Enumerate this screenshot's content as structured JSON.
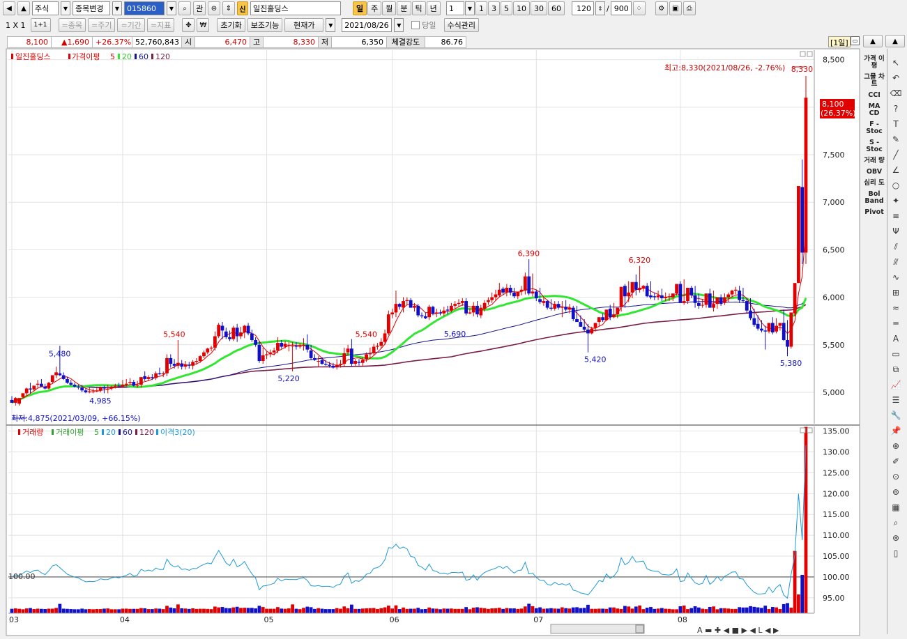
{
  "toolbar": {
    "market": "주식",
    "change_button": "종목변경",
    "code": "015860",
    "gwan": "관",
    "new_badge": "신",
    "stock_name": "일진홀딩스",
    "periods": [
      "일",
      "주",
      "월",
      "분",
      "틱",
      "년"
    ],
    "active_period": "일",
    "interval_value": "1",
    "interval_presets": [
      "1",
      "3",
      "5",
      "10",
      "30",
      "60"
    ],
    "count_value": "120",
    "count_sep": "/",
    "count_total": "900"
  },
  "toolbar2": {
    "layout": "1 X 1",
    "layout_small": "1+1",
    "disabled_buttons": [
      "=종목",
      "=주기",
      "=기간",
      "=지표"
    ],
    "pan_icon": "move-icon",
    "init_button": "초기화",
    "aux_button": "보조기능",
    "price_type": "현재가",
    "date": "2021/08/26",
    "same_day_label": "당일",
    "formula_button": "수식관리"
  },
  "quote": {
    "price": "8,100",
    "change": "▲1,690",
    "rate": "+26.37%",
    "volume": "52,760,843",
    "open_label": "시",
    "open": "6,470",
    "high_label": "고",
    "high": "8,330",
    "low_label": "저",
    "low": "6,350",
    "strength_label": "체결강도",
    "strength": "86.76",
    "period_badge": "[1일]"
  },
  "price_panel": {
    "legend": [
      "일진홀딩스",
      "가격이평",
      "5",
      "20",
      "60",
      "120"
    ],
    "max_text": "최고:8,330(2021/08/26, -2.76%)",
    "min_text": "최저:4,875(2021/03/09, +66.15%)",
    "current_tag": [
      "8,100",
      "(26.37%)"
    ]
  },
  "volume_panel": {
    "legend": [
      "거래량",
      "거래이평",
      "5",
      "20",
      "60",
      "120",
      "이격3(20)"
    ],
    "ref_label": "100.00"
  },
  "right_panel": {
    "indicators": [
      "가격 이평",
      "그물 차트",
      "CCI",
      "MA CD",
      "F - Stoc",
      "S - Stoc",
      "거래 량",
      "OBV",
      "심리 도",
      "Bol Band",
      "Pivot"
    ],
    "tools": [
      "cursor-icon",
      "undo-icon",
      "eraser-icon",
      "help-icon",
      "text-tool-icon",
      "pencil-icon",
      "line-icon",
      "angle-icon",
      "circle-icon",
      "star-icon",
      "parallel-icon",
      "fibo-icon",
      "fan-icon",
      "channel-icon",
      "cycle-icon",
      "grid-icon",
      "wave-icon",
      "hline-icon",
      "auto-icon",
      "window-icon",
      "copy-icon",
      "chart-icon",
      "list-icon",
      "wrench-icon",
      "pin-icon",
      "zoom-in-icon",
      "marker-icon",
      "find-icon",
      "find2-icon",
      "excel-icon",
      "magnify-icon",
      "target-icon",
      "clip-icon"
    ]
  },
  "colors": {
    "up": "#e00000",
    "down": "#1010c8",
    "ma5": "#e00000",
    "ma20": "#32e632",
    "ma60": "#14148c",
    "ma120": "#781e46",
    "disparity": "#1e9ad8"
  },
  "chart_data": {
    "type": "candlestick",
    "title": "일진홀딩스",
    "x_ticks": [
      "03",
      "04",
      "05",
      "06",
      "07",
      "08"
    ],
    "x_tick_index": [
      0,
      30,
      69,
      103,
      142,
      181
    ],
    "ylim": [
      4670,
      8600
    ],
    "y_ticks": [
      "5,000",
      "5,500",
      "6,000",
      "6,500",
      "7,000",
      "7,500",
      "8,000",
      "8,500"
    ],
    "y_tick_values": [
      5000,
      5500,
      6000,
      6500,
      7000,
      7500,
      8000,
      8500
    ],
    "annotations": [
      {
        "i": 13,
        "v": 5480,
        "label": "5,480",
        "color": "#1010c8"
      },
      {
        "i": 24,
        "v": 4985,
        "label": "4,985",
        "color": "#1010c8"
      },
      {
        "i": 44,
        "v": 5540,
        "label": "5,540",
        "color": "#e00000"
      },
      {
        "i": 75,
        "v": 5220,
        "label": "5,220",
        "color": "#1010c8"
      },
      {
        "i": 96,
        "v": 5540,
        "label": "5,540",
        "color": "#e00000"
      },
      {
        "i": 120,
        "v": 5690,
        "label": "5,690",
        "color": "#1010c8"
      },
      {
        "i": 140,
        "v": 6390,
        "label": "6,390",
        "color": "#e00000"
      },
      {
        "i": 158,
        "v": 5420,
        "label": "5,420",
        "color": "#1010c8"
      },
      {
        "i": 170,
        "v": 6320,
        "label": "6,320",
        "color": "#e00000"
      },
      {
        "i": 211,
        "v": 5380,
        "label": "5,380",
        "color": "#1010c8"
      },
      {
        "i": 214,
        "v": 8330,
        "label": "8,330",
        "color": "#e00000"
      }
    ],
    "candles": {
      "open": [
        4920,
        4890,
        4880,
        4950,
        4990,
        5040,
        5030,
        5080,
        5090,
        5060,
        5040,
        5110,
        5180,
        5200,
        5180,
        5140,
        5100,
        5080,
        5060,
        5050,
        5020,
        5000,
        5010,
        5010,
        5020,
        5050,
        5040,
        5040,
        5060,
        5070,
        5060,
        5080,
        5100,
        5110,
        5070,
        5080,
        5170,
        5140,
        5160,
        5150,
        5200,
        5190,
        5200,
        5360,
        5300,
        5280,
        5300,
        5270,
        5290,
        5280,
        5320,
        5330,
        5380,
        5420,
        5460,
        5470,
        5590,
        5700,
        5640,
        5580,
        5560,
        5680,
        5590,
        5630,
        5700,
        5620,
        5550,
        5500,
        5330,
        5390,
        5400,
        5420,
        5440,
        5520,
        5480,
        5500,
        5490,
        5490,
        5480,
        5490,
        5500,
        5440,
        5360,
        5330,
        5340,
        5300,
        5290,
        5280,
        5270,
        5290,
        5300,
        5420,
        5460,
        5300,
        5320,
        5310,
        5350,
        5400,
        5410,
        5480,
        5490,
        5530,
        5620,
        5820,
        5840,
        5930,
        5890,
        5960,
        5970,
        5890,
        5910,
        5810,
        5800,
        5790,
        5900,
        5830,
        5840,
        5830,
        5870,
        5860,
        5910,
        5930,
        5940,
        5960,
        5830,
        5840,
        5910,
        5810,
        5880,
        5950,
        5970,
        6000,
        6020,
        6090,
        6050,
        6100,
        6050,
        6010,
        6060,
        6070,
        6220,
        6040,
        6060,
        5980,
        5940,
        5960,
        5890,
        5880,
        5930,
        5890,
        5900,
        5870,
        5890,
        5770,
        5740,
        5690,
        5660,
        5620,
        5680,
        5740,
        5790,
        5760,
        5880,
        5790,
        5820,
        5900,
        6120,
        6010,
        6050,
        6160,
        6080,
        6090,
        6120,
        6020,
        6010,
        6000,
        6020,
        5990,
        6000,
        6000,
        6040,
        6140,
        5940,
        5960,
        6100,
        6020,
        5940,
        5920,
        5920,
        6040,
        5890,
        5930,
        6000,
        5940,
        6000,
        6030,
        6070,
        6070,
        5970,
        5960,
        5860,
        5780,
        5720,
        5670,
        5650,
        5640,
        5730,
        5640,
        5700,
        5730,
        5550,
        5480,
        5830,
        6150,
        7160,
        6470
      ],
      "high": [
        4960,
        4950,
        4930,
        4990,
        5050,
        5100,
        5070,
        5130,
        5140,
        5090,
        5110,
        5170,
        5270,
        5490,
        5210,
        5160,
        5130,
        5100,
        5080,
        5080,
        5040,
        5050,
        5040,
        5060,
        5060,
        5070,
        5080,
        5070,
        5090,
        5100,
        5130,
        5140,
        5150,
        5130,
        5120,
        5160,
        5220,
        5180,
        5190,
        5220,
        5260,
        5220,
        5400,
        5400,
        5350,
        5550,
        5340,
        5330,
        5320,
        5340,
        5360,
        5390,
        5440,
        5470,
        5490,
        5640,
        5730,
        5740,
        5680,
        5650,
        5700,
        5720,
        5690,
        5710,
        5730,
        5660,
        5580,
        5540,
        5470,
        5430,
        5450,
        5470,
        5580,
        5550,
        5540,
        5530,
        5530,
        5530,
        5520,
        5570,
        5610,
        5500,
        5400,
        5380,
        5370,
        5340,
        5320,
        5310,
        5350,
        5340,
        5470,
        5500,
        5560,
        5350,
        5350,
        5370,
        5420,
        5470,
        5510,
        5520,
        5570,
        5660,
        5860,
        5880,
        6070,
        5940,
        6000,
        6000,
        5990,
        5940,
        5930,
        5840,
        5840,
        5920,
        5910,
        5880,
        5870,
        5900,
        5910,
        5940,
        5960,
        5980,
        5990,
        5990,
        5880,
        5950,
        5960,
        5920,
        5970,
        6000,
        6050,
        6080,
        6150,
        6110,
        6140,
        6130,
        6100,
        6060,
        6120,
        6260,
        6400,
        6250,
        6080,
        6100,
        6000,
        5970,
        5980,
        5960,
        5960,
        5960,
        5970,
        5930,
        5910,
        5910,
        5810,
        5770,
        5720,
        5690,
        5720,
        5790,
        5830,
        5830,
        5920,
        5940,
        5880,
        5930,
        6140,
        6170,
        6090,
        6240,
        6330,
        6130,
        6150,
        6170,
        6050,
        6070,
        6090,
        6050,
        6040,
        6020,
        6080,
        6170,
        6190,
        6000,
        6120,
        6120,
        6040,
        5980,
        5960,
        6090,
        6070,
        5940,
        6030,
        6040,
        6050,
        6080,
        6110,
        6120,
        6100,
        5990,
        5990,
        5880,
        5810,
        5760,
        5700,
        5690,
        5790,
        5780,
        5720,
        5870,
        5760,
        5610,
        5860,
        6320,
        7450,
        8330
      ],
      "low": [
        4890,
        4860,
        4860,
        4940,
        4960,
        4990,
        5010,
        5050,
        5070,
        5030,
        5030,
        5090,
        5150,
        5170,
        5130,
        5090,
        5070,
        5050,
        5030,
        5000,
        4990,
        4990,
        4990,
        5000,
        5000,
        4990,
        4990,
        5020,
        5040,
        5050,
        5050,
        5060,
        5080,
        5060,
        5050,
        5050,
        5120,
        5120,
        5130,
        5130,
        5180,
        5160,
        5170,
        5260,
        5250,
        5250,
        5240,
        5240,
        5250,
        5240,
        5290,
        5310,
        5360,
        5400,
        5430,
        5440,
        5570,
        5560,
        5560,
        5540,
        5540,
        5530,
        5560,
        5570,
        5600,
        5530,
        5480,
        5310,
        5300,
        5350,
        5370,
        5390,
        5410,
        5460,
        5460,
        5430,
        5220,
        5450,
        5460,
        5440,
        5420,
        5340,
        5330,
        5270,
        5290,
        5280,
        5260,
        5250,
        5240,
        5260,
        5270,
        5390,
        5270,
        5280,
        5280,
        5280,
        5320,
        5360,
        5390,
        5450,
        5460,
        5500,
        5600,
        5780,
        5790,
        5870,
        5840,
        5920,
        5900,
        5850,
        5790,
        5780,
        5770,
        5760,
        5810,
        5790,
        5810,
        5800,
        5820,
        5840,
        5880,
        5900,
        5910,
        5810,
        5820,
        5800,
        5790,
        5780,
        5850,
        5920,
        5940,
        5960,
        6000,
        6030,
        6010,
        6020,
        5990,
        5980,
        6020,
        6030,
        6020,
        6010,
        5960,
        5930,
        5910,
        5870,
        5860,
        5860,
        5870,
        5790,
        5850,
        5830,
        5750,
        5740,
        5690,
        5640,
        5420,
        5610,
        5640,
        5700,
        5740,
        5750,
        5760,
        5780,
        5780,
        5850,
        5890,
        5950,
        5990,
        6020,
        6050,
        6060,
        6000,
        5980,
        5970,
        5970,
        5960,
        5960,
        5960,
        5960,
        6020,
        5940,
        5920,
        5930,
        5990,
        5890,
        5880,
        5890,
        5890,
        5900,
        5850,
        5880,
        5910,
        5920,
        5950,
        6000,
        6030,
        5940,
        5940,
        5830,
        5760,
        5690,
        5650,
        5630,
        5450,
        5620,
        5610,
        5620,
        5650,
        5540,
        5380,
        5460,
        5800,
        6150,
        6350,
        6350
      ],
      "close": [
        4890,
        4940,
        4940,
        4990,
        5040,
        5030,
        5070,
        5090,
        5060,
        5040,
        5100,
        5180,
        5210,
        5180,
        5140,
        5100,
        5080,
        5060,
        5050,
        5020,
        5000,
        5010,
        5010,
        5020,
        5050,
        5040,
        5040,
        5060,
        5070,
        5060,
        5080,
        5090,
        5110,
        5070,
        5080,
        5160,
        5140,
        5160,
        5150,
        5200,
        5190,
        5200,
        5360,
        5300,
        5280,
        5310,
        5270,
        5290,
        5280,
        5320,
        5330,
        5380,
        5420,
        5460,
        5470,
        5590,
        5710,
        5650,
        5580,
        5560,
        5680,
        5590,
        5630,
        5700,
        5620,
        5550,
        5500,
        5330,
        5390,
        5400,
        5420,
        5440,
        5520,
        5480,
        5510,
        5500,
        5490,
        5480,
        5490,
        5500,
        5450,
        5360,
        5340,
        5330,
        5300,
        5290,
        5280,
        5260,
        5290,
        5300,
        5410,
        5460,
        5300,
        5330,
        5310,
        5340,
        5400,
        5410,
        5480,
        5490,
        5530,
        5620,
        5820,
        5840,
        5930,
        5900,
        5960,
        5970,
        5890,
        5910,
        5810,
        5800,
        5780,
        5900,
        5830,
        5840,
        5830,
        5860,
        5860,
        5910,
        5930,
        5940,
        5960,
        5830,
        5840,
        5910,
        5820,
        5890,
        5940,
        5970,
        6000,
        6030,
        6080,
        6050,
        6100,
        6050,
        6010,
        6060,
        6080,
        6220,
        6040,
        6060,
        5990,
        5950,
        5960,
        5890,
        5880,
        5930,
        5890,
        5900,
        5870,
        5890,
        5770,
        5740,
        5690,
        5660,
        5620,
        5670,
        5730,
        5790,
        5760,
        5870,
        5790,
        5820,
        5890,
        6110,
        6010,
        6050,
        6160,
        6080,
        6100,
        6120,
        6010,
        6000,
        6000,
        6020,
        5990,
        6000,
        6010,
        6040,
        6140,
        5940,
        5960,
        6100,
        6020,
        5940,
        5910,
        5920,
        6040,
        5890,
        5930,
        6000,
        5930,
        6000,
        6030,
        6070,
        6080,
        5970,
        5960,
        5860,
        5780,
        5710,
        5670,
        5650,
        5640,
        5730,
        5630,
        5700,
        5730,
        5550,
        5480,
        5840,
        6150,
        7170,
        6470,
        8100
      ]
    },
    "volume_ylim": [
      91.3,
      136.1
    ],
    "volume_y_ticks": [
      "95.00",
      "100.00",
      "105.00",
      "110.00",
      "115.00",
      "120.00",
      "125.00",
      "130.00",
      "135.00"
    ],
    "volume_y_tick_values": [
      95,
      100,
      105,
      110,
      115,
      120,
      125,
      130,
      135
    ],
    "disparity_ref": 100
  }
}
